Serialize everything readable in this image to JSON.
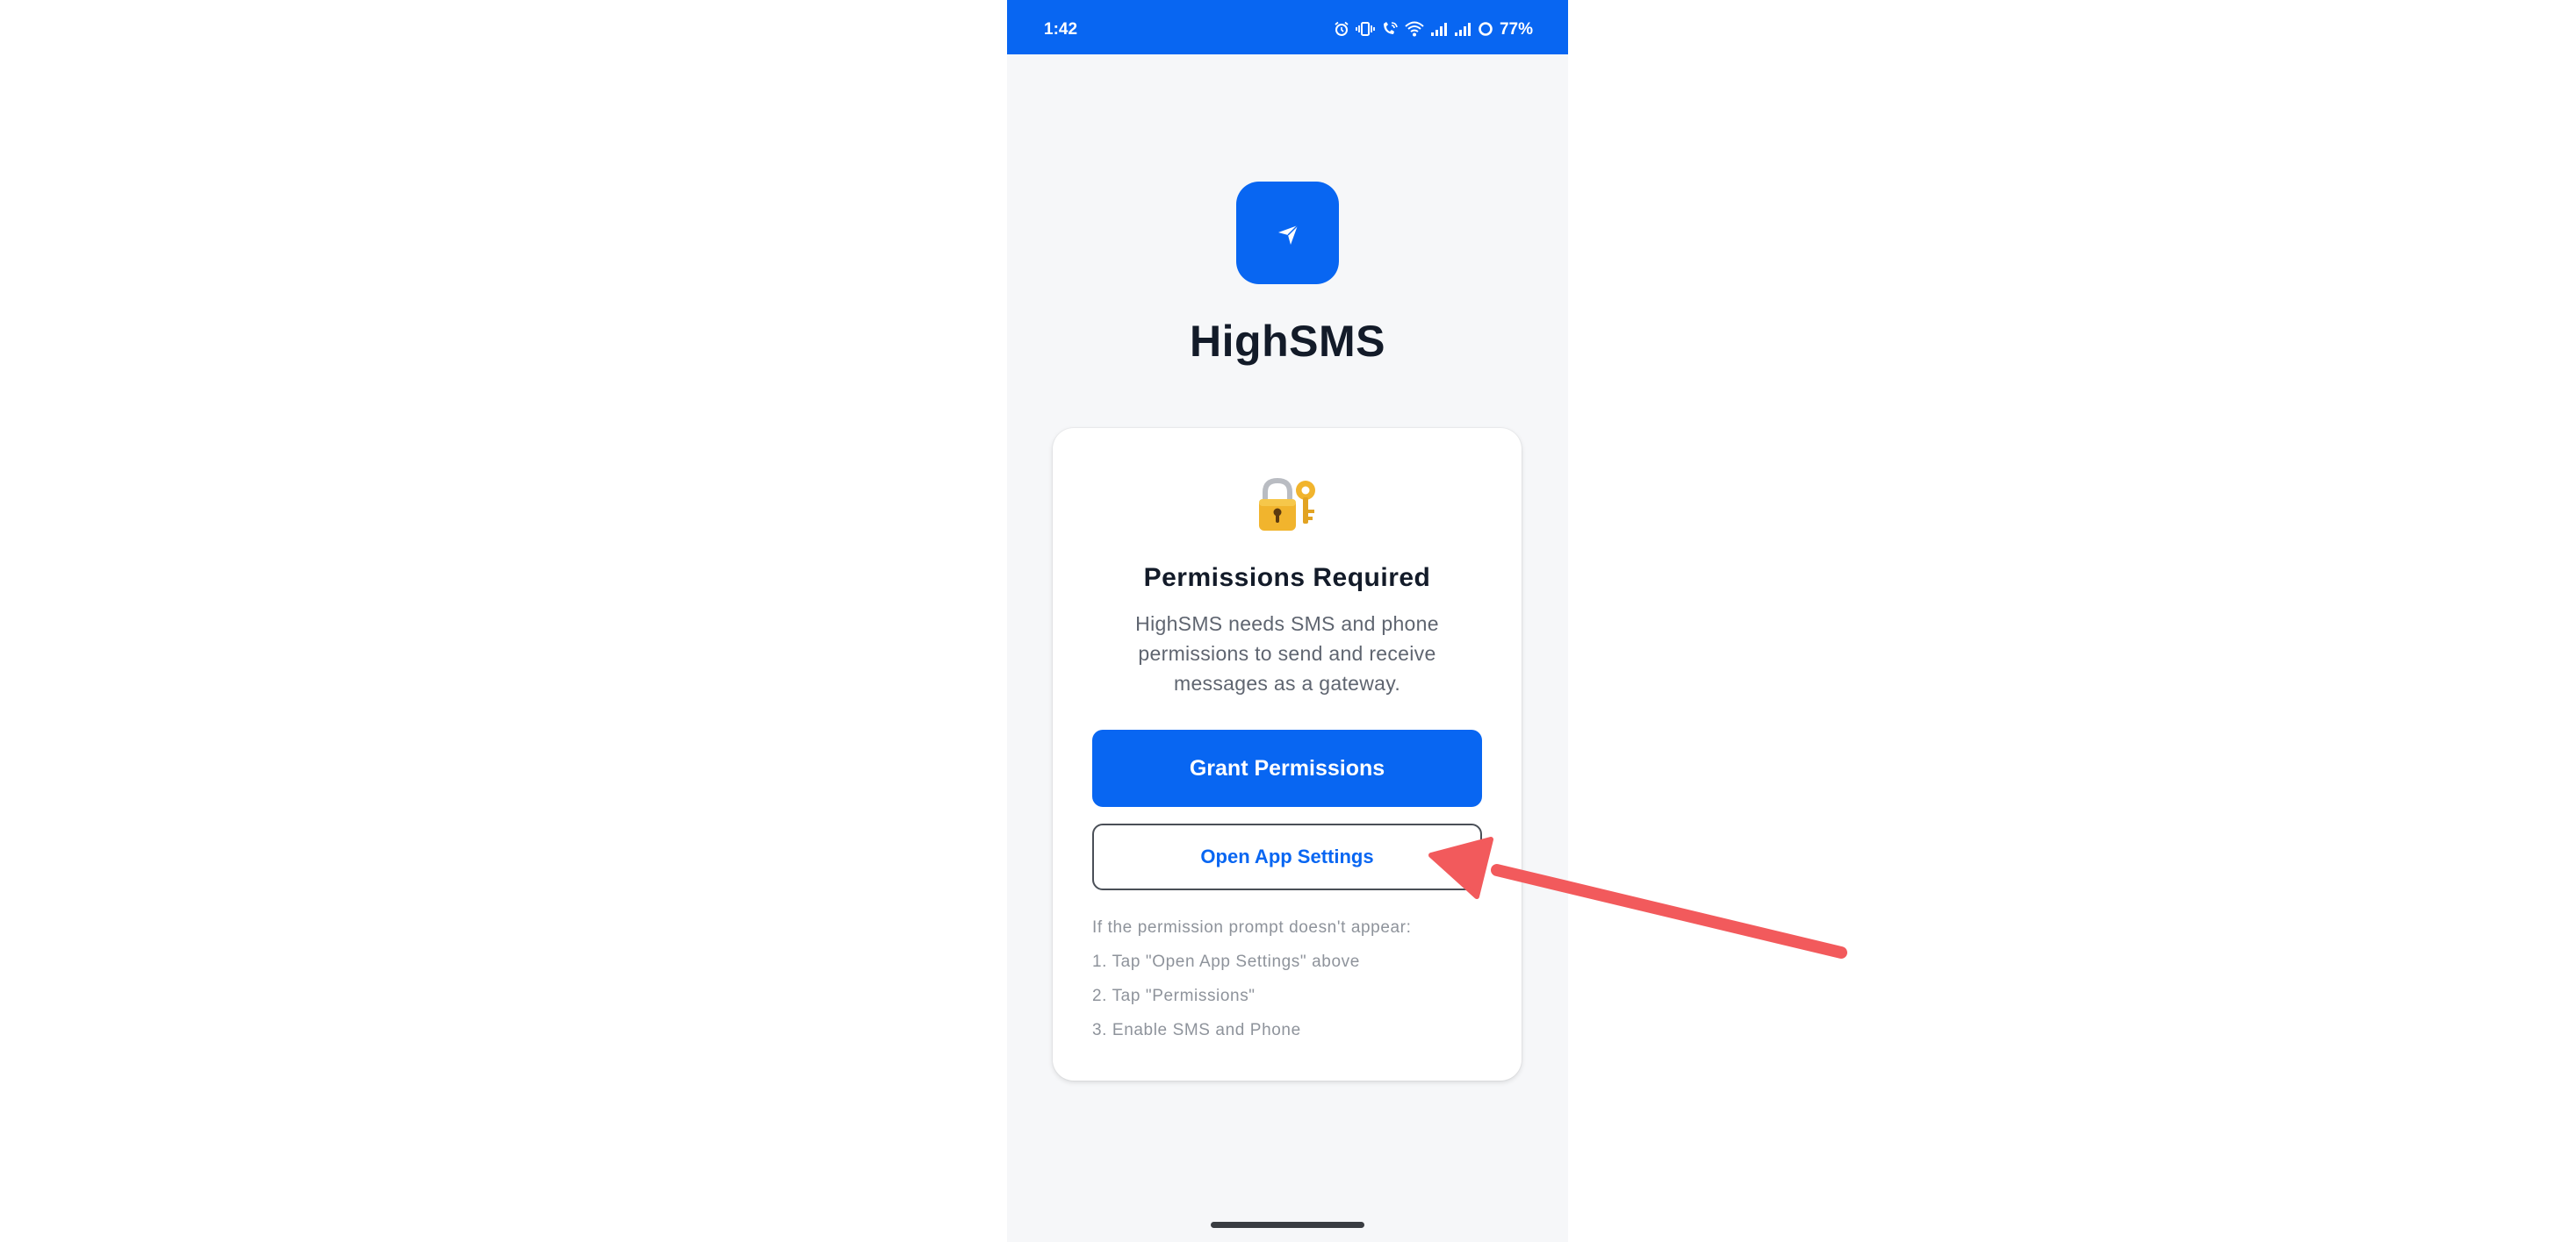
{
  "status_bar": {
    "time": "1:42",
    "battery": "77%",
    "icons": [
      "alarm-icon",
      "vibrate-icon",
      "wifi-calling-icon",
      "wifi-icon",
      "signal-icon",
      "signal-icon",
      "battery-ring-icon"
    ]
  },
  "app": {
    "logo_icon": "paper-plane-icon",
    "title": "HighSMS"
  },
  "card": {
    "icon": "lock-with-key-icon",
    "title": "Permissions Required",
    "description": "HighSMS needs SMS and phone permissions to send and receive messages as a gateway.",
    "grant_button_label": "Grant Permissions",
    "settings_button_label": "Open App Settings",
    "help_lines": [
      "If the permission prompt doesn't appear:",
      "1. Tap \"Open App Settings\" above",
      "2. Tap \"Permissions\"",
      "3. Enable SMS and Phone"
    ]
  },
  "colors": {
    "brand": "#0866f2",
    "background": "#f6f7f9",
    "annotation_arrow": "#f25a5c"
  }
}
